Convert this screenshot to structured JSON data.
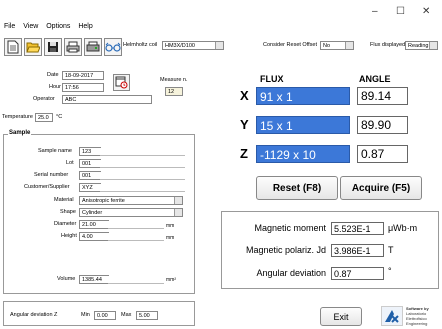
{
  "window": {
    "minimize": "–",
    "maximize": "☐",
    "close": "✕"
  },
  "menu": [
    "File",
    "View",
    "Options",
    "Help"
  ],
  "toolbar": [
    {
      "icon": "new-document-icon"
    },
    {
      "icon": "open-folder-icon"
    },
    {
      "icon": "save-icon"
    },
    {
      "icon": "print-icon"
    },
    {
      "icon": "printer-settings-icon"
    },
    {
      "icon": "glasses-icon"
    }
  ],
  "helmholtz": {
    "label": "Helmholtz coil",
    "value": "HM3X/D100"
  },
  "reset_offset": {
    "label": "Consider Reset Offset",
    "value": "No"
  },
  "flux_displayed": {
    "label": "Flux displayed",
    "value": "Reading"
  },
  "date": {
    "label": "Date",
    "value": "18-09-2017"
  },
  "hour": {
    "label": "Hour",
    "value": "17:56"
  },
  "measure": {
    "label": "Measure n.",
    "value": "12"
  },
  "operator": {
    "label": "Operator",
    "value": "ABC"
  },
  "temperature": {
    "label": "Temperature",
    "value": "25.0",
    "unit": "°C"
  },
  "sample": {
    "title": "Sample",
    "name": {
      "label": "Sample name",
      "value": "123"
    },
    "lot": {
      "label": "Lot",
      "value": "001"
    },
    "serial": {
      "label": "Serial number",
      "value": "001"
    },
    "customer": {
      "label": "Customer/Supplier",
      "value": "XYZ"
    },
    "material": {
      "label": "Material",
      "value": "Anisotropic ferrite"
    },
    "shape": {
      "label": "Shape",
      "value": "Cylinder"
    },
    "diameter": {
      "label": "Diameter",
      "value": "21.00",
      "unit": "mm"
    },
    "height": {
      "label": "Height",
      "value": "4.00",
      "unit": "mm"
    },
    "volume": {
      "label": "Volume",
      "value": "1385.44",
      "unit": "mm²"
    }
  },
  "angdev": {
    "label": "Angular deviation Z",
    "min_label": "Min",
    "min": "0.00",
    "max_label": "Max",
    "max": "5.00"
  },
  "readings": {
    "flux_header": "FLUX",
    "angle_header": "ANGLE",
    "x": {
      "axis": "X",
      "flux": "91 x 1",
      "angle": "89.14"
    },
    "y": {
      "axis": "Y",
      "flux": "15 x 1",
      "angle": "89.90"
    },
    "z": {
      "axis": "Z",
      "flux": "-1129 x 10",
      "angle": "0.87"
    }
  },
  "buttons": {
    "reset": "Reset (F8)",
    "acquire": "Acquire (F5)",
    "exit": "Exit"
  },
  "results": {
    "moment": {
      "label": "Magnetic moment",
      "value": "5.523E-1",
      "unit": "μWb·m"
    },
    "polariz": {
      "label": "Magnetic polariz. Jd",
      "value": "3.986E-1",
      "unit": "T"
    },
    "angdev": {
      "label": "Angular deviation",
      "value": "0.87",
      "unit": "°"
    }
  },
  "logo": {
    "line1": "Software by",
    "line2": "Laboratorio",
    "line3": "Elettrofisico",
    "line4": "Engineering"
  }
}
